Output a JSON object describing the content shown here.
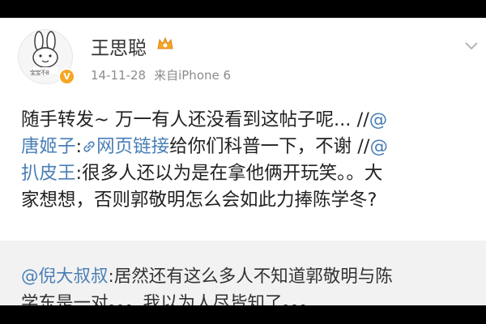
{
  "post": {
    "username": "王思聪",
    "avatar_text": "宝宝不8",
    "verified_badge": "V",
    "date": "14-11-28",
    "source": "来自iPhone 6",
    "icons": {
      "vip": "vip-crown-icon",
      "more": "chevron-down-icon",
      "link": "link-icon"
    }
  },
  "content": {
    "l1_text": "随手转发~ 万一有人还没看到这帖子呢... //",
    "l1_mention": "@",
    "l2_mention": "唐姬子",
    "l2_colon": ":",
    "l2_link_label": "网页链接",
    "l2_text": "给你们科普一下，不谢 //",
    "l2_at": "@",
    "l3_mention": "扒皮王",
    "l3_text": ":很多人还以为是在拿他俩开玩笑。。大",
    "l4_text": "家想想，否则郭敬明怎么会如此力捧陈学冬?"
  },
  "quoted": {
    "mention": "@倪大叔叔",
    "q1_text": ":居然还有这么多人不知道郭敬明与陈",
    "q2_text": "学东是一对。。。我以为人尽皆知了。。。"
  },
  "colors": {
    "link": "#4a7fb5",
    "badge": "#f5a623",
    "quote_bg": "#f2f2f2"
  }
}
